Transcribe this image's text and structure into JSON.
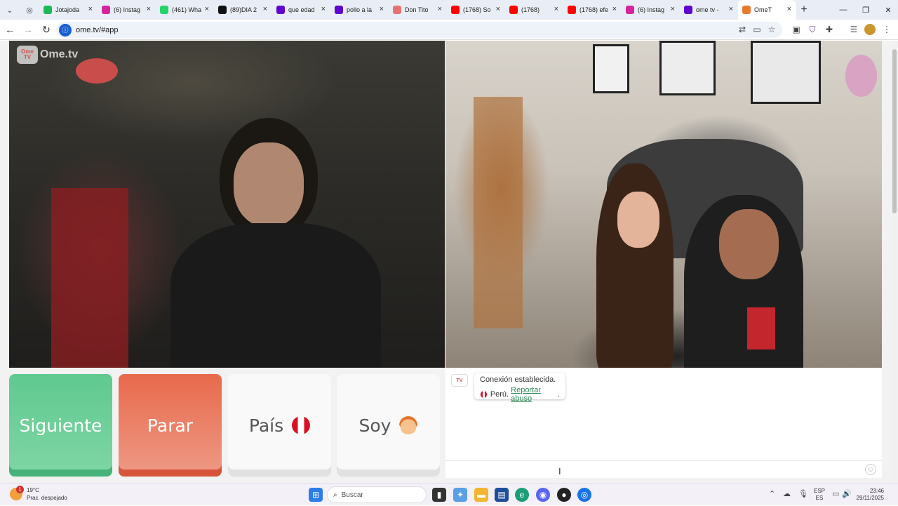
{
  "browser": {
    "tabs": [
      {
        "title": "Jotajoda",
        "favicon_color": "#1db954"
      },
      {
        "title": "(6) Instag",
        "favicon_color": "#d6249f"
      },
      {
        "title": "(461) Wha",
        "favicon_color": "#25d366"
      },
      {
        "title": "(89)DIA 2",
        "favicon_color": "#111111"
      },
      {
        "title": "que edad",
        "favicon_color": "#6001d2"
      },
      {
        "title": "pollo a la",
        "favicon_color": "#6001d2"
      },
      {
        "title": "Don Tito",
        "favicon_color": "#e57373"
      },
      {
        "title": "(1768) So",
        "favicon_color": "#ff0000"
      },
      {
        "title": "(1768)",
        "favicon_color": "#ff0000"
      },
      {
        "title": "(1768) efe",
        "favicon_color": "#ff0000"
      },
      {
        "title": "(6) Instag",
        "favicon_color": "#d6249f"
      },
      {
        "title": "ome tv -",
        "favicon_color": "#6001d2"
      },
      {
        "title": "OmeT",
        "favicon_color": "#e87a2c",
        "active": true
      }
    ],
    "url": "ome.tv/#app"
  },
  "app": {
    "logo_text": "Ome.tv",
    "logo_badge": "Ome TV",
    "buttons": {
      "next": "Siguiente",
      "stop": "Parar",
      "country": "País",
      "iam": "Soy"
    },
    "chat": {
      "status": "Conexión establecida.",
      "country": "Perú.",
      "report": "Reportar abuso",
      "report_suffix": "."
    }
  },
  "taskbar": {
    "weather_temp": "19°C",
    "weather_desc": "Prac. despejado",
    "weather_badge": "1",
    "search_placeholder": "Buscar",
    "lang_top": "ESP",
    "lang_bottom": "ES",
    "time": "23:46",
    "date": "29/11/2025"
  },
  "colors": {
    "next_green": "#5fc98e",
    "stop_red": "#e86a4c",
    "report_link": "#2e8b57"
  }
}
